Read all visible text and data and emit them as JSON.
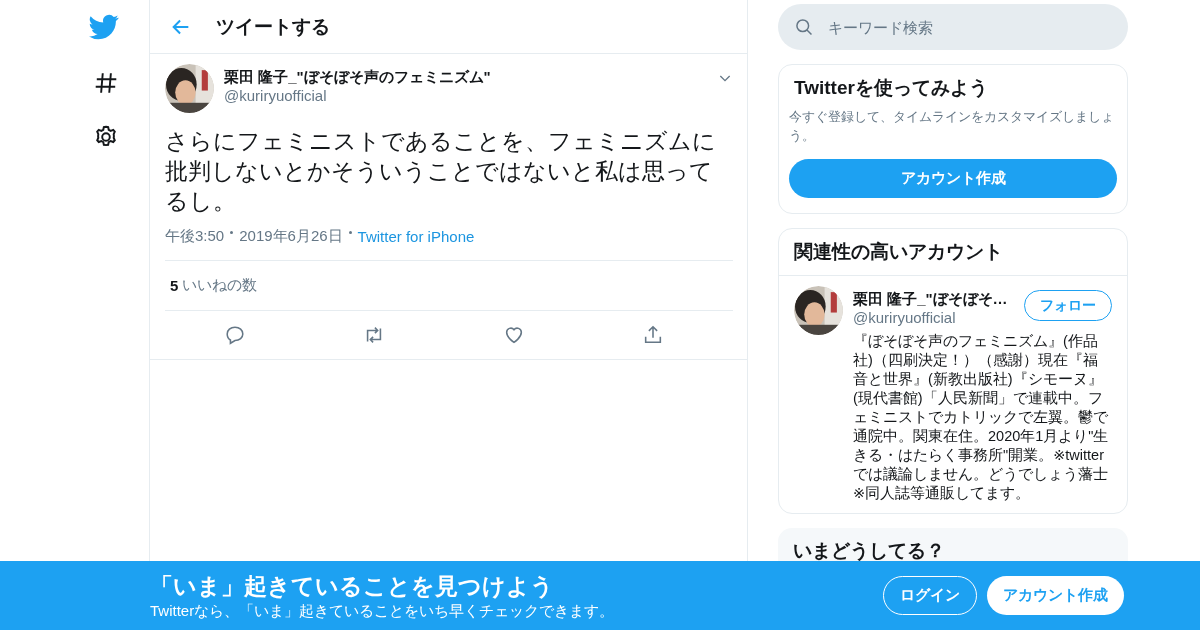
{
  "header": {
    "title": "ツイートする"
  },
  "tweet": {
    "name": "栗田 隆子_\"ぼそぼそ声のフェミニズム\"",
    "handle": "@kuriryuofficial",
    "text": "さらにフェミニストであることを、フェミニズムに批判しないとかそういうことではないと私は思ってるし。",
    "time": "午後3:50",
    "date": "2019年6月26日",
    "source": "Twitter for iPhone",
    "like_count": "5",
    "like_label": "いいねの数"
  },
  "search": {
    "placeholder": "キーワード検索"
  },
  "signup_card": {
    "title": "Twitterを使ってみよう",
    "text": "今すぐ登録して、タイムラインをカスタマイズしましょう。",
    "button": "アカウント作成"
  },
  "related": {
    "title": "関連性の高いアカウント",
    "accounts": [
      {
        "name": "栗田 隆子_\"ぼそぼそ…",
        "handle": "@kuriryuofficial",
        "button": "フォロー",
        "bio": "『ぼそぼそ声のフェミニズム』(作品社)（四刷決定！）（感謝）現在『福音と世界』(新教出版社)『シモーヌ』(現代書館)「人民新聞」で連載中。フェミニストでカトリックで左翼。鬱で通院中。関東在住。2020年1月より\"生きる・はたらく事務所\"開業。※twitterでは議論しません。どうでしょう藩士※同人誌等通販してます。"
      }
    ]
  },
  "trends": {
    "title": "いまどうしてる？"
  },
  "banner": {
    "title": "「いま」起きていることを見つけよう",
    "text": "Twitterなら、「いま」起きていることをいち早くチェックできます。",
    "login": "ログイン",
    "signup": "アカウント作成"
  }
}
